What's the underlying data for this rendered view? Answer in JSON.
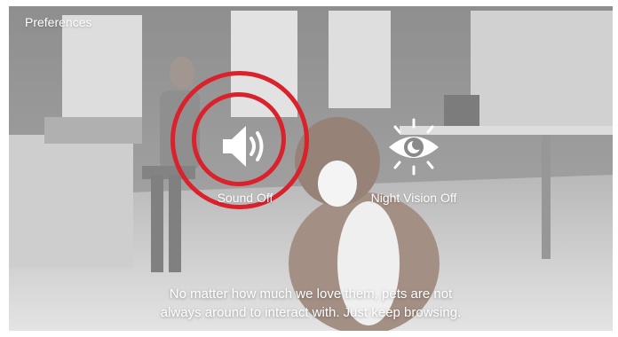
{
  "header": {
    "title": "Preferences"
  },
  "controls": {
    "sound": {
      "label": "Sound Off",
      "icon": "speaker-icon"
    },
    "night_vision": {
      "label": "Night Vision Off",
      "icon": "eye-moon-icon"
    }
  },
  "message": {
    "line1": "No matter how much we love them, pets are not",
    "line2": "always around to interact with. Just keep browsing."
  },
  "colors": {
    "highlight_ring": "#d9222b",
    "text": "#ffffff"
  }
}
